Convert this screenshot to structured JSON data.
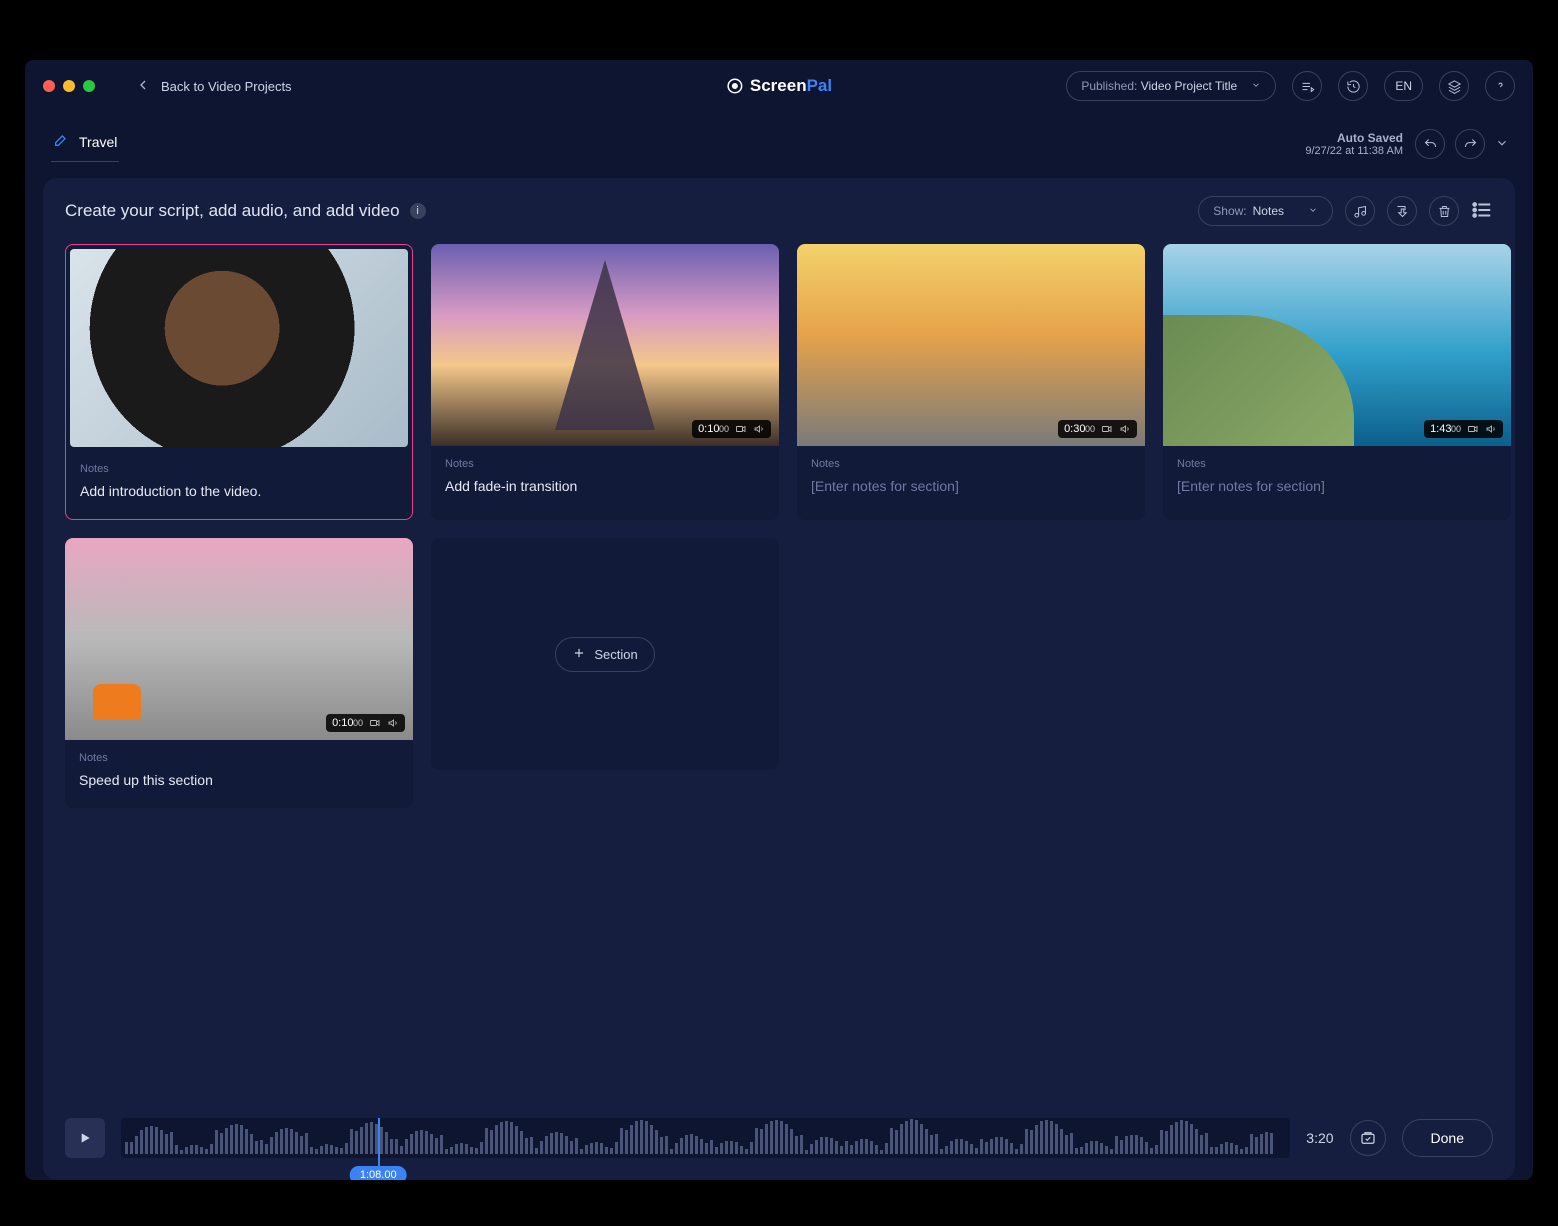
{
  "topbar": {
    "back_label": "Back to Video Projects",
    "brand_a": "Screen",
    "brand_b": "Pal",
    "status_label": "Published:",
    "status_value": "Video Project Title",
    "lang": "EN"
  },
  "titlebar": {
    "project_name": "Travel",
    "autosave_label": "Auto Saved",
    "autosave_time": "9/27/22 at 11:38 AM"
  },
  "panel": {
    "instruction": "Create your script, add audio, and add video",
    "show_label": "Show:",
    "show_value": "Notes",
    "add_section": "Section"
  },
  "sections": [
    {
      "notes_label": "Notes",
      "note": "Add introduction to the video.",
      "time": null,
      "selected": true,
      "thumb": "portrait"
    },
    {
      "notes_label": "Notes",
      "note": "Add fade-in transition",
      "time": "0:10",
      "time_sub": ".00",
      "selected": false,
      "thumb": "eiffel"
    },
    {
      "notes_label": "Notes",
      "note": "",
      "placeholder": "[Enter notes for section]",
      "time": "0:30",
      "time_sub": ".00",
      "selected": false,
      "thumb": "street"
    },
    {
      "notes_label": "Notes",
      "note": "",
      "placeholder": "[Enter notes for section]",
      "time": "1:43",
      "time_sub": ".00",
      "selected": false,
      "thumb": "coast"
    },
    {
      "notes_label": "Notes",
      "note": "Speed up this section",
      "time": "0:10",
      "time_sub": ".00",
      "selected": false,
      "thumb": "alley"
    }
  ],
  "footer": {
    "playhead_time": "1:08.00",
    "total_time": "3:20",
    "done": "Done"
  }
}
